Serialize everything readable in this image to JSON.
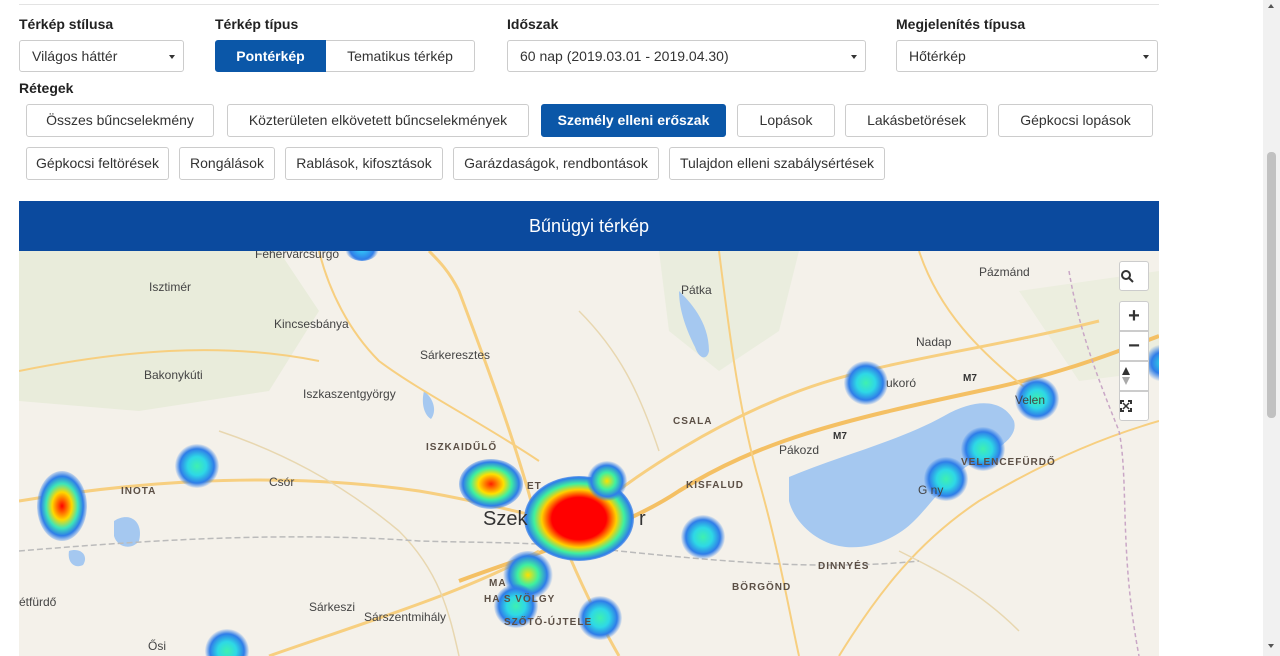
{
  "filters": {
    "style_label": "Térkép stílusa",
    "style_value": "Világos háttér",
    "type_label": "Térkép típus",
    "type_options": [
      "Pontérkép",
      "Tematikus térkép"
    ],
    "period_label": "Időszak",
    "period_value": "60 nap (2019.03.01 - 2019.04.30)",
    "display_label": "Megjelenítés típusa",
    "display_value": "Hőtérkép"
  },
  "layers": {
    "label": "Rétegek",
    "items": [
      "Összes bűncselekmény",
      "Közterületen elkövetett bűncselekmények",
      "Személy elleni erőszak",
      "Lopások",
      "Lakásbetörések",
      "Gépkocsi lopások",
      "Gépkocsi feltörések",
      "Rongálások",
      "Rablások, kifosztások",
      "Garázdaságok, rendbontások",
      "Tulajdon elleni szabálysértések"
    ],
    "active": "Személy elleni erőszak"
  },
  "map": {
    "title": "Bűnügyi térkép",
    "places": {
      "fehervarcsurgo": "Fehérvarcsurgó",
      "isztimer": "Isztimér",
      "kincsesbanya": "Kincsesbánya",
      "sarkeresztes": "Sárkeresztes",
      "bakonykuti": "Bakonykúti",
      "iszkaszentgyorgy": "Iszkaszentgyörgy",
      "iszkaidulo": "ISZKAIDŰLŐ",
      "inota": "INOTA",
      "csor": "Csór",
      "szekesfehervar_left": "Szek",
      "szekesfehervar_right": "r",
      "kisfalud": "KISFALUD",
      "csala": "CSALA",
      "patka": "Pátka",
      "pazmand": "Pázmánd",
      "nadap": "Nadap",
      "sukoro": "ukoró",
      "velence": "Velen",
      "velencefurdo": "VELENCEFÜRDŐ",
      "gardony": "G      ny",
      "pakozd": "Pákozd",
      "dinnyes": "DINNYÉS",
      "borgond": "BÖRGÖND",
      "sarkeszi": "Sárkeszi",
      "sarszentmihaly": "Sárszentmihály",
      "osi": "Ősi",
      "etfurdo": "étfürdő",
      "maroshegy": "MA",
      "harsfavolgy": "HA  S  VÖLGY",
      "szoto_ujtelek": "SZŐTŐ-ÚJTELE",
      "city_abbrev": "ET"
    },
    "roads": {
      "m7_a": "M7",
      "m7_b": "M7"
    },
    "controls": {
      "search_icon": "search-icon",
      "zoom_in": "+",
      "zoom_out": "−",
      "compass_icon": "compass-icon",
      "fullscreen_icon": "fullscreen-icon"
    }
  },
  "colors": {
    "primary": "#0b57a8",
    "banner": "#0b4a9e",
    "water": "#a5c8f0",
    "road": "#f7cf80"
  }
}
